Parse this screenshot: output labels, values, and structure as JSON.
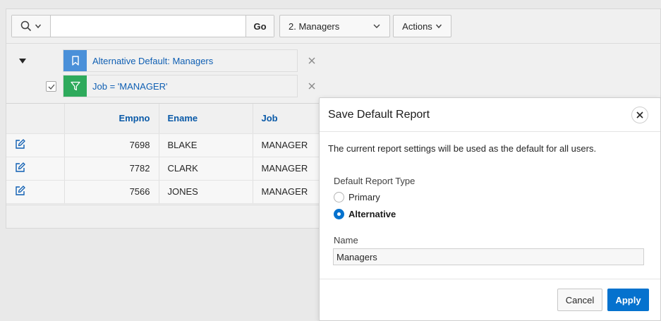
{
  "toolbar": {
    "search_value": "",
    "go_label": "Go",
    "report_selected": "2. Managers",
    "actions_label": "Actions"
  },
  "filters": {
    "saved_report_label": "Alternative Default: Managers",
    "filter_label": "Job = 'MANAGER'",
    "saved_report_color": "#4a90d9",
    "filter_color": "#2eaa5c"
  },
  "grid": {
    "columns": [
      "",
      "Empno",
      "Ename",
      "Job"
    ],
    "rows": [
      {
        "empno": "7698",
        "ename": "BLAKE",
        "job": "MANAGER"
      },
      {
        "empno": "7782",
        "ename": "CLARK",
        "job": "MANAGER"
      },
      {
        "empno": "7566",
        "ename": "JONES",
        "job": "MANAGER"
      }
    ]
  },
  "dialog": {
    "title": "Save Default Report",
    "description": "The current report settings will be used as the default for all users.",
    "type_label": "Default Report Type",
    "options": [
      {
        "label": "Primary",
        "checked": false
      },
      {
        "label": "Alternative",
        "checked": true
      }
    ],
    "name_label": "Name",
    "name_value": "Managers",
    "cancel_label": "Cancel",
    "apply_label": "Apply"
  },
  "colors": {
    "accent": "#0572ce",
    "link": "#0f5fb3"
  }
}
